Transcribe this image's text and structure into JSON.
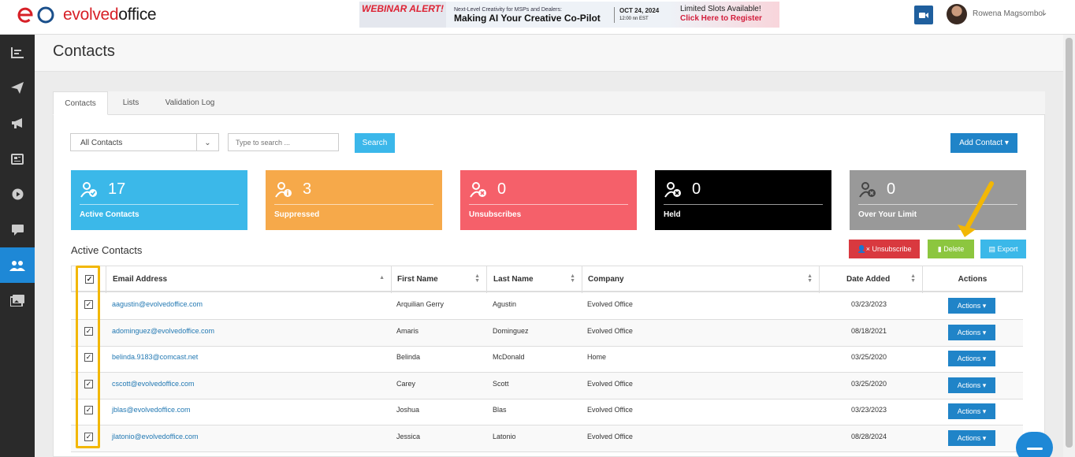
{
  "app": {
    "logo_text_a": "evolved",
    "logo_text_b": "office"
  },
  "banner": {
    "badge": "WEBINAR ALERT!",
    "subtitle": "Next-Level Creativity for MSPs and Dealers:",
    "title": "Making AI Your Creative Co-Pilot",
    "date": "OCT 24, 2024",
    "time": "12:00 nn EST",
    "cta_line1": "Limited Slots Available!",
    "cta_line2": "Click Here to Register"
  },
  "user": {
    "name": "Rowena Magsombol"
  },
  "sidebar": {
    "items": [
      {
        "icon": "chart-icon"
      },
      {
        "icon": "paper-plane-icon"
      },
      {
        "icon": "megaphone-icon"
      },
      {
        "icon": "newspaper-icon"
      },
      {
        "icon": "play-circle-icon"
      },
      {
        "icon": "chat-icon"
      },
      {
        "icon": "users-icon",
        "active": true
      },
      {
        "icon": "images-icon"
      }
    ]
  },
  "page": {
    "title": "Contacts"
  },
  "tabs": [
    {
      "label": "Contacts",
      "active": true
    },
    {
      "label": "Lists"
    },
    {
      "label": "Validation Log"
    }
  ],
  "filters": {
    "select_value": "All Contacts",
    "search_placeholder": "Type to search ...",
    "search_button": "Search",
    "add_contact_button": "Add Contact"
  },
  "stats": [
    {
      "value": "17",
      "label": "Active Contacts",
      "color": "#3bb8e9"
    },
    {
      "value": "3",
      "label": "Suppressed",
      "color": "#f6a94a"
    },
    {
      "value": "0",
      "label": "Unsubscribes",
      "color": "#f5606a"
    },
    {
      "value": "0",
      "label": "Held",
      "color": "#000000"
    },
    {
      "value": "0",
      "label": "Over Your Limit",
      "color": "#999999"
    }
  ],
  "section": {
    "title": "Active Contacts",
    "unsubscribe_button": "Unsubscribe",
    "delete_button": "Delete",
    "export_button": "Export"
  },
  "table": {
    "columns": [
      "Email Address",
      "First Name",
      "Last Name",
      "Company",
      "Date Added",
      "Actions"
    ],
    "rows": [
      {
        "email": "aagustin@evolvedoffice.com",
        "first": "Arquilian Gerry",
        "last": "Agustin",
        "company": "Evolved Office",
        "date": "03/23/2023",
        "action": "Actions"
      },
      {
        "email": "adominguez@evolvedoffice.com",
        "first": "Amaris",
        "last": "Dominguez",
        "company": "Evolved Office",
        "date": "08/18/2021",
        "action": "Actions"
      },
      {
        "email": "belinda.9183@comcast.net",
        "first": "Belinda",
        "last": "McDonald",
        "company": "Home",
        "date": "03/25/2020",
        "action": "Actions"
      },
      {
        "email": "cscott@evolvedoffice.com",
        "first": "Carey",
        "last": "Scott",
        "company": "Evolved Office",
        "date": "03/25/2020",
        "action": "Actions"
      },
      {
        "email": "jblas@evolvedoffice.com",
        "first": "Joshua",
        "last": "Blas",
        "company": "Evolved Office",
        "date": "03/23/2023",
        "action": "Actions"
      },
      {
        "email": "jlatonio@evolvedoffice.com",
        "first": "Jessica",
        "last": "Latonio",
        "company": "Evolved Office",
        "date": "08/28/2024",
        "action": "Actions"
      }
    ]
  }
}
